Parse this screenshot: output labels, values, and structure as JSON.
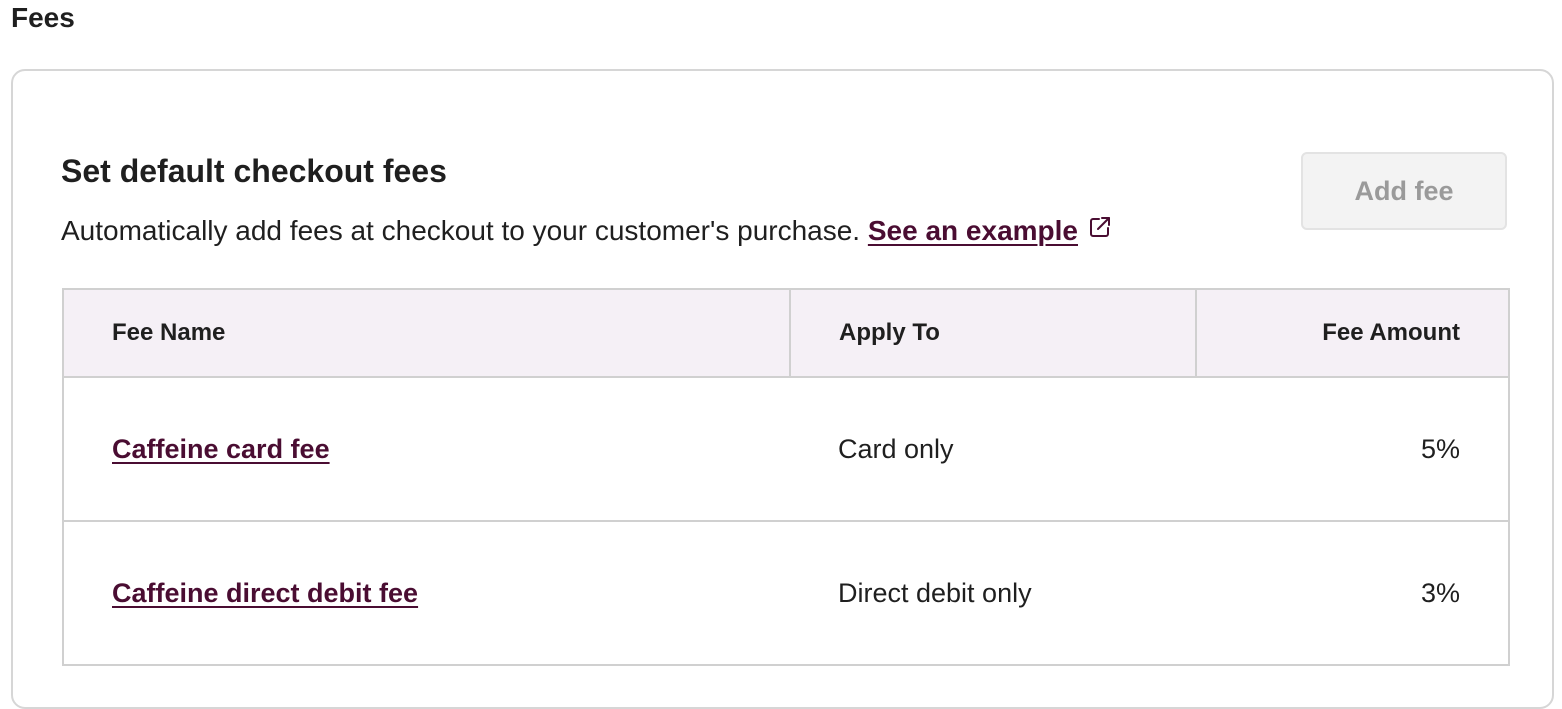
{
  "page": {
    "title": "Fees"
  },
  "section": {
    "title": "Set default checkout fees",
    "description": "Automatically add fees at checkout to your customer's purchase.",
    "example_link": "See an example",
    "add_button": "Add fee"
  },
  "table": {
    "headers": {
      "name": "Fee Name",
      "apply_to": "Apply To",
      "amount": "Fee Amount"
    },
    "rows": [
      {
        "name": "Caffeine card fee",
        "apply_to": "Card only",
        "amount": "5%"
      },
      {
        "name": "Caffeine direct debit fee",
        "apply_to": "Direct debit only",
        "amount": "3%"
      }
    ]
  },
  "colors": {
    "link": "#4a0d32",
    "header_bg": "#f5f0f6",
    "border": "#d0d0d0",
    "disabled_button_bg": "#f3f3f3",
    "disabled_button_text": "#9a9a9a"
  },
  "icons": {
    "external_link": "external-link-icon"
  }
}
